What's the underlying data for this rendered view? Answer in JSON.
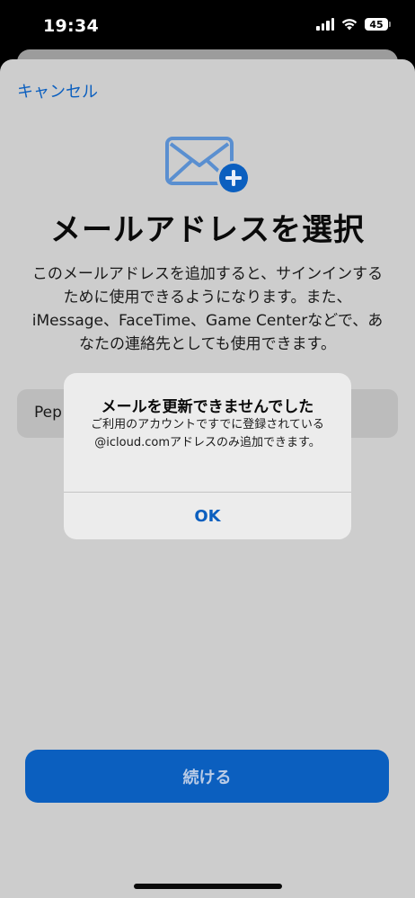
{
  "status_bar": {
    "time": "19:34",
    "battery": "45"
  },
  "sheet": {
    "cancel_label": "キャンセル",
    "title": "メールアドレスを選択",
    "description": "このメールアドレスを追加すると、サインインするために使用できるようになります。また、iMessage、FaceTime、Game Centerなどで、あなたの連絡先としても使用できます。",
    "input_value": "Pep",
    "continue_label": "続ける"
  },
  "alert": {
    "title": "メールを更新できませんでした",
    "message": "ご利用のアカウントですでに登録されている@icloud.comアドレスのみ追加できます。",
    "ok_label": "OK"
  },
  "colors": {
    "accent": "#0b5fbf",
    "mail_icon": "#5a8fd0",
    "plus_badge": "#0b5fbf"
  },
  "icons": {
    "mail": "mail-add-icon",
    "plus": "plus-badge-icon"
  }
}
